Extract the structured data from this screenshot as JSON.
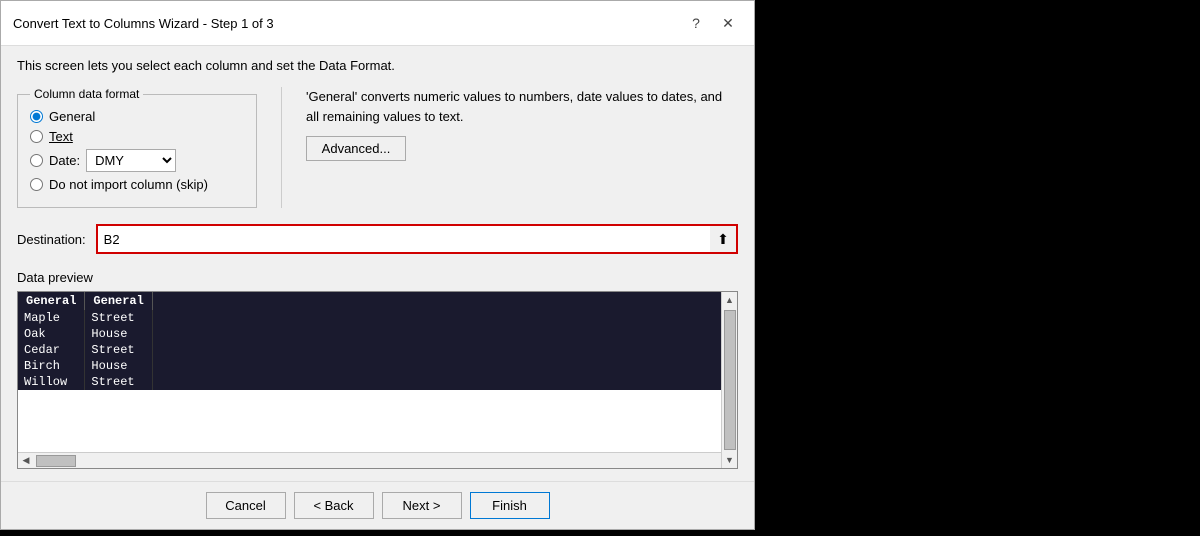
{
  "dialog": {
    "title": "Convert Text to Columns Wizard - Step 1 of 3",
    "help_icon": "?",
    "close_icon": "✕"
  },
  "intro": {
    "text": "This screen lets you select each column and set the Data Format."
  },
  "column_data_format": {
    "label": "Column data format",
    "options": [
      {
        "id": "general",
        "label": "General",
        "checked": true
      },
      {
        "id": "text",
        "label": "Text",
        "checked": false
      },
      {
        "id": "date",
        "label": "Date:",
        "checked": false
      },
      {
        "id": "skip",
        "label": "Do not import column (skip)",
        "checked": false
      }
    ],
    "date_value": "DMY"
  },
  "description": {
    "text": "'General' converts numeric values to numbers, date values to dates, and all remaining values to text."
  },
  "advanced_button": {
    "label": "Advanced..."
  },
  "destination": {
    "label": "Destination:",
    "value": "B2",
    "icon": "⬆"
  },
  "data_preview": {
    "label": "Data preview",
    "columns": [
      "General",
      "General"
    ],
    "rows": [
      [
        "Maple",
        "Street"
      ],
      [
        "Oak",
        "House"
      ],
      [
        "Cedar",
        "Street"
      ],
      [
        "Birch",
        "House"
      ],
      [
        "Willow",
        "Street"
      ]
    ]
  },
  "footer": {
    "cancel": "Cancel",
    "back": "< Back",
    "next": "Next >",
    "finish": "Finish"
  }
}
